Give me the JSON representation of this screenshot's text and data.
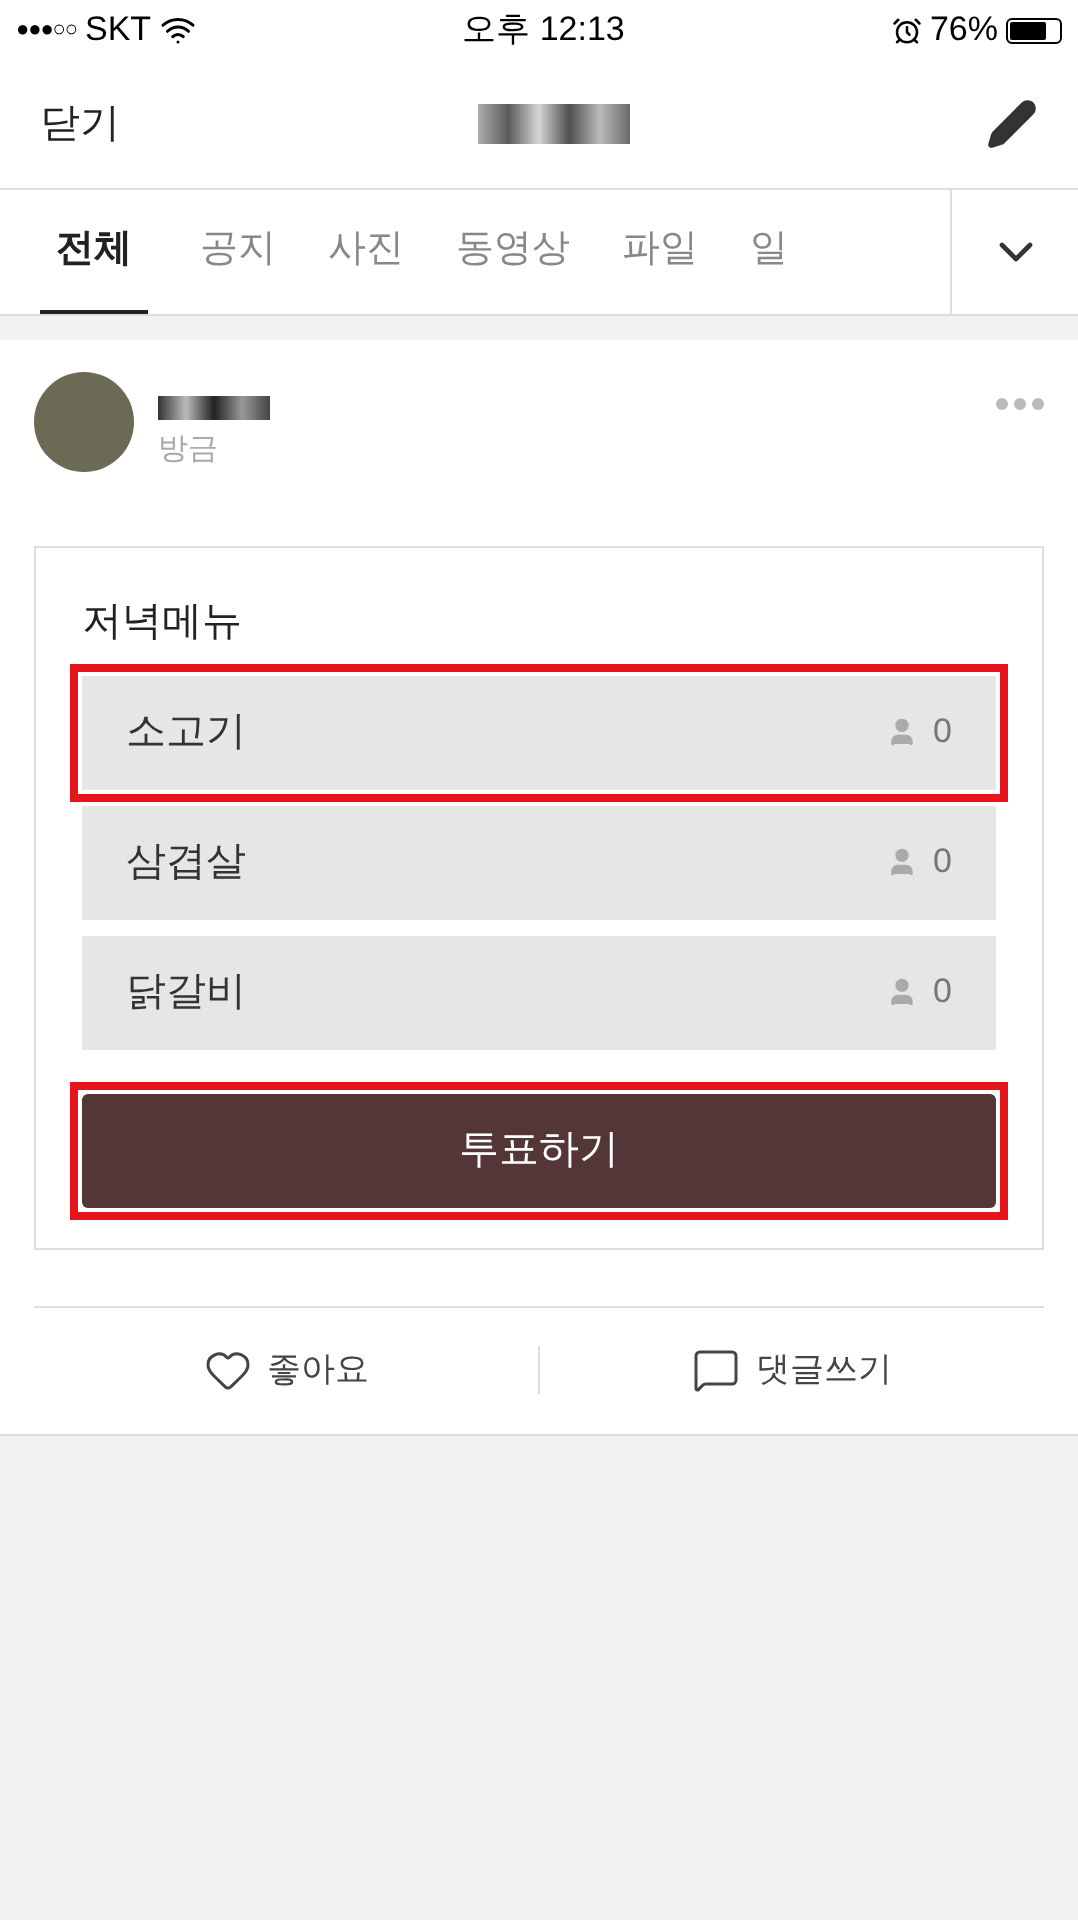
{
  "status_bar": {
    "signal": "●●●○○",
    "carrier": "SKT",
    "time": "오후 12:13",
    "battery": "76%"
  },
  "nav": {
    "close": "닫기"
  },
  "tabs": [
    {
      "label": "전체",
      "selected": true
    },
    {
      "label": "공지",
      "selected": false
    },
    {
      "label": "사진",
      "selected": false
    },
    {
      "label": "동영상",
      "selected": false
    },
    {
      "label": "파일",
      "selected": false
    },
    {
      "label": "일",
      "selected": false
    }
  ],
  "post": {
    "time": "방금",
    "poll": {
      "title": "저녁메뉴",
      "options": [
        {
          "label": "소고기",
          "count": "0",
          "highlighted": true
        },
        {
          "label": "삼겹살",
          "count": "0",
          "highlighted": false
        },
        {
          "label": "닭갈비",
          "count": "0",
          "highlighted": false
        }
      ],
      "vote_button": {
        "label": "투표하기",
        "highlighted": true
      }
    }
  },
  "actions": {
    "like": "좋아요",
    "comment": "댓글쓰기"
  }
}
